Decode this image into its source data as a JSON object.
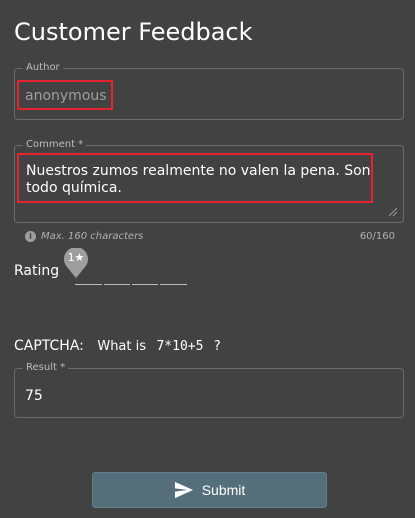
{
  "page": {
    "title": "Customer Feedback"
  },
  "author": {
    "legend": "Author",
    "value": "anonymous"
  },
  "comment": {
    "legend": "Comment *",
    "value": "Nuestros zumos realmente no valen la pena. Son todo química.",
    "hint_icon": "info-icon",
    "hint": "Max. 160 characters",
    "counter": "60/160"
  },
  "rating": {
    "label": "Rating",
    "thumb_label": "1★",
    "value": 1,
    "max": 5
  },
  "captcha": {
    "label": "CAPTCHA:",
    "question": "What is",
    "expression": "7*10+5",
    "suffix": "?"
  },
  "result": {
    "legend": "Result *",
    "value": "75"
  },
  "submit": {
    "label": "Submit",
    "icon": "send-icon"
  },
  "colors": {
    "background": "#424242",
    "highlight": "#e32430",
    "button": "#546e7a"
  }
}
